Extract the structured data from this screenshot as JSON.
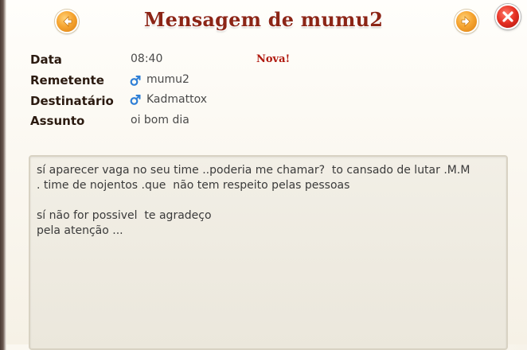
{
  "header": {
    "title": "Mensagem de mumu2",
    "prev_icon": "arrow-left-icon",
    "next_icon": "arrow-right-icon",
    "close_icon": "close-icon"
  },
  "fields": {
    "date_label": "Data",
    "date_value": "08:40",
    "new_badge": "Nova!",
    "sender_label": "Remetente",
    "sender_value": "mumu2",
    "recipient_label": "Destinatário",
    "recipient_value": "Kadmattox",
    "subject_label": "Assunto",
    "subject_value": "oi bom dia",
    "gender_icon": "male-icon"
  },
  "message": {
    "body": "sí aparecer vaga no seu time ..poderia me chamar?  to cansado de lutar .M.M\n. time de nojentos .que  não tem respeito pelas pessoas\n\nsí não for possivel  te agradeço\npela atenção ..."
  },
  "colors": {
    "title": "#8c2516",
    "badge": "#b01a10",
    "arrow_button": "#f6a531",
    "close_button": "#e52f22",
    "male_icon": "#2f7fd6"
  }
}
